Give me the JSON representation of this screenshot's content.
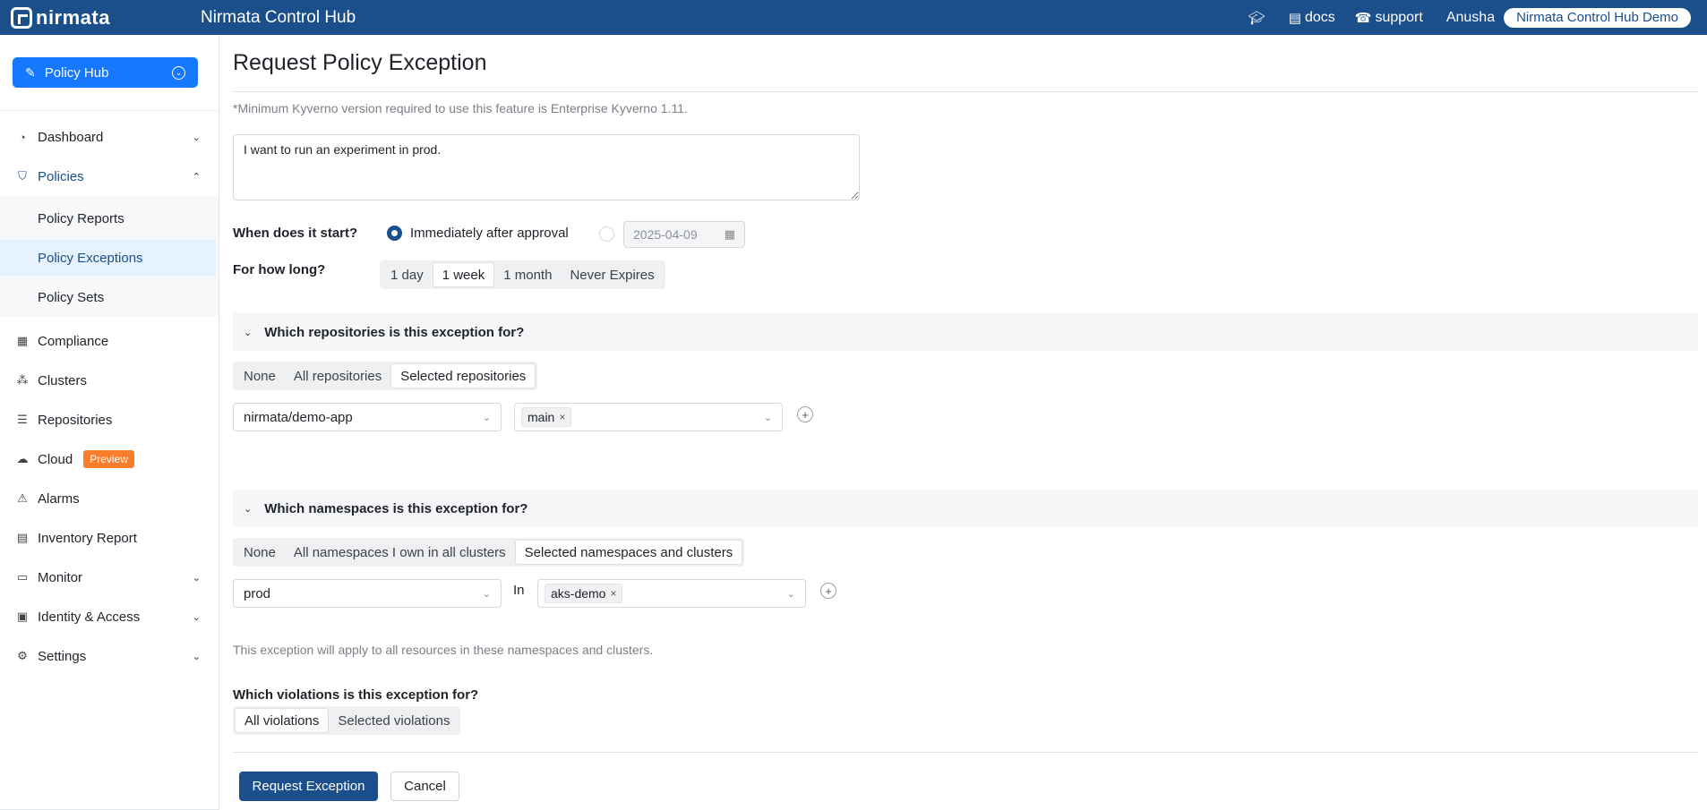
{
  "topbar": {
    "logo_text": "nirmata",
    "app_title": "Nirmata Control Hub",
    "docs_label": "docs",
    "support_label": "support",
    "user_name": "Anusha",
    "org_name": "Nirmata Control Hub Demo",
    "icons": [
      "graduation-cap-icon",
      "book-icon",
      "phone-icon"
    ]
  },
  "sidebar": {
    "hub_button": "Policy Hub",
    "items": [
      {
        "label": "Dashboard",
        "icon": "dashboard-icon"
      },
      {
        "label": "Policies",
        "icon": "shield-icon"
      },
      {
        "label": "Compliance",
        "icon": "clipboard-icon"
      },
      {
        "label": "Clusters",
        "icon": "cluster-icon"
      },
      {
        "label": "Repositories",
        "icon": "repository-icon"
      },
      {
        "label": "Cloud",
        "icon": "cloud-icon",
        "badge": "Preview"
      },
      {
        "label": "Alarms",
        "icon": "warning-icon"
      },
      {
        "label": "Inventory Report",
        "icon": "report-icon"
      },
      {
        "label": "Monitor",
        "icon": "monitor-icon"
      },
      {
        "label": "Identity & Access",
        "icon": "id-card-icon"
      },
      {
        "label": "Settings",
        "icon": "gear-icon"
      }
    ],
    "policies_sub": [
      "Policy Reports",
      "Policy Exceptions",
      "Policy Sets"
    ],
    "selected_sub": "Policy Exceptions"
  },
  "form": {
    "title": "Request Policy Exception",
    "note": "*Minimum Kyverno version required to use this feature is Enterprise Kyverno 1.11.",
    "reason_value": "I want to run an experiment in prod.",
    "start": {
      "label": "When does it start?",
      "option_immediate": "Immediately after approval",
      "date_value": "2025-04-09",
      "selected": "Immediately after approval"
    },
    "duration": {
      "label": "For how long?",
      "options": [
        "1 day",
        "1 week",
        "1 month",
        "Never Expires"
      ],
      "selected": "1 week"
    },
    "repositories": {
      "heading": "Which repositories is this exception for?",
      "options": [
        "None",
        "All repositories",
        "Selected repositories"
      ],
      "selected": "Selected repositories",
      "repo_value": "nirmata/demo-app",
      "branch_tag": "main"
    },
    "namespaces": {
      "heading": "Which namespaces is this exception for?",
      "options": [
        "None",
        "All namespaces I own in all clusters",
        "Selected namespaces and clusters"
      ],
      "selected": "Selected namespaces and clusters",
      "namespace_value": "prod",
      "in_label": "In",
      "cluster_tag": "aks-demo",
      "helper": "This exception will apply to all resources in these namespaces and clusters."
    },
    "violations": {
      "label": "Which violations is this exception for?",
      "options": [
        "All violations",
        "Selected violations"
      ],
      "selected": "All violations"
    },
    "submit_label": "Request Exception",
    "cancel_label": "Cancel"
  },
  "colors": {
    "brand": "#1a4f8b",
    "accent": "#1677ff",
    "badge": "#fa7d2c"
  }
}
